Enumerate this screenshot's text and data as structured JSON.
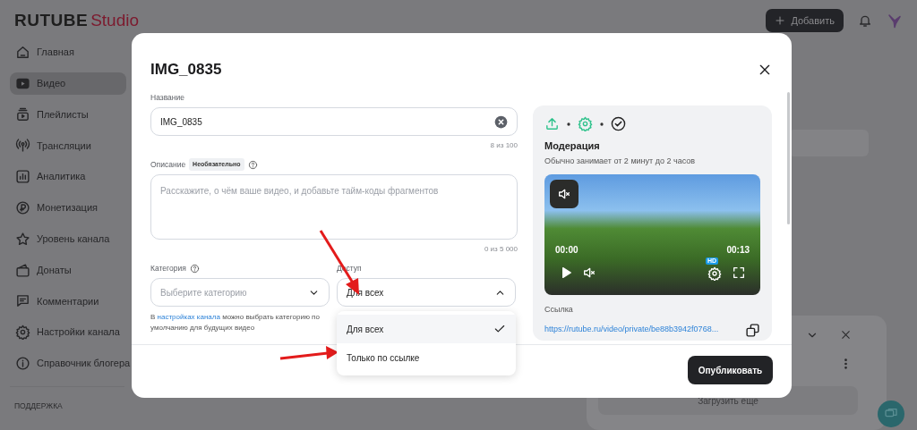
{
  "header": {
    "logo_main": "RUTUBE",
    "logo_accent": "Studio",
    "add_button": "Добавить"
  },
  "sidebar": {
    "items": [
      {
        "label": "Главная",
        "selected": false
      },
      {
        "label": "Видео",
        "selected": true
      },
      {
        "label": "Плейлисты",
        "selected": false
      },
      {
        "label": "Трансляции",
        "selected": false
      },
      {
        "label": "Аналитика",
        "selected": false
      },
      {
        "label": "Монетизация",
        "selected": false
      },
      {
        "label": "Уровень канала",
        "selected": false
      },
      {
        "label": "Донаты",
        "selected": false
      },
      {
        "label": "Комментарии",
        "selected": false
      },
      {
        "label": "Настройки канала",
        "selected": false
      },
      {
        "label": "Справочник блогера",
        "selected": false
      }
    ],
    "section_title": "ПОДДЕРЖКА"
  },
  "uploads_panel": {
    "load_more_button": "Загрузить еще"
  },
  "modal": {
    "title": "IMG_0835",
    "name_field": {
      "label": "Название",
      "value": "IMG_0835",
      "counter": "8 из 100"
    },
    "description_field": {
      "label": "Описание",
      "badge": "Необязательно",
      "placeholder": "Расскажите, о чём ваше видео, и добавьте тайм-коды фрагментов",
      "counter": "0 из 5 000"
    },
    "category_field": {
      "label": "Категория",
      "placeholder": "Выберите категорию",
      "hint_before": "В",
      "hint_link": "настройках канала",
      "hint_after": "можно выбрать категорию по умолчанию для будущих видео"
    },
    "access_field": {
      "label": "Доступ",
      "value": "Для всех",
      "expanded": true,
      "options": [
        {
          "label": "Для всех",
          "selected": true
        },
        {
          "label": "Только по ссылке",
          "selected": false
        }
      ]
    },
    "status": {
      "steps": [
        {
          "completed": true
        },
        {
          "completed": true
        },
        {
          "completed": false
        }
      ],
      "title": "Модерация",
      "subtitle": "Обычно занимает от 2 минут до 2 часов"
    },
    "player": {
      "current_time": "00:00",
      "duration": "00:13",
      "quality_badge": "HD"
    },
    "link": {
      "label": "Ссылка",
      "url": "https://rutube.ru/video/private/be88b3942f0768..."
    },
    "publish_button": "Опубликовать"
  }
}
